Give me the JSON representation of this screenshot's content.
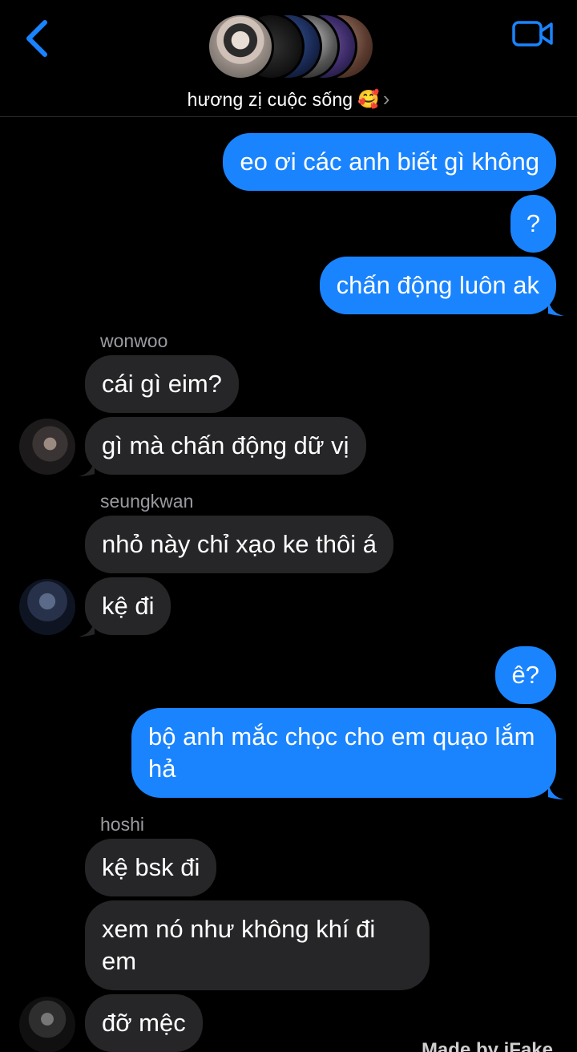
{
  "header": {
    "group_name": "hương zị cuộc sống",
    "emoji": "🥰",
    "chevron": "›"
  },
  "messages": [
    {
      "side": "out",
      "text": "eo ơi các anh biết gì không"
    },
    {
      "side": "out",
      "text": "?"
    },
    {
      "side": "out",
      "text": "chấn động luôn ak"
    },
    {
      "side": "in",
      "sender": "wonwoo",
      "text": "cái gì eim?"
    },
    {
      "side": "in",
      "text": "gì mà chấn động dữ vị"
    },
    {
      "side": "in",
      "sender": "seungkwan",
      "text": "nhỏ này chỉ xạo ke thôi á"
    },
    {
      "side": "in",
      "text": "kệ đi"
    },
    {
      "side": "out",
      "text": "ê?"
    },
    {
      "side": "out",
      "text": "bộ anh mắc chọc cho em quạo lắm hả"
    },
    {
      "side": "in",
      "sender": "hoshi",
      "text": "kệ bsk đi"
    },
    {
      "side": "in",
      "text": "xem nó như không khí đi em"
    },
    {
      "side": "in",
      "text": "đỡ mệc"
    }
  ],
  "watermark": "Made by iFake",
  "colors": {
    "outgoing": "#1a84ff",
    "incoming": "#262628",
    "accent": "#1a84ff"
  }
}
